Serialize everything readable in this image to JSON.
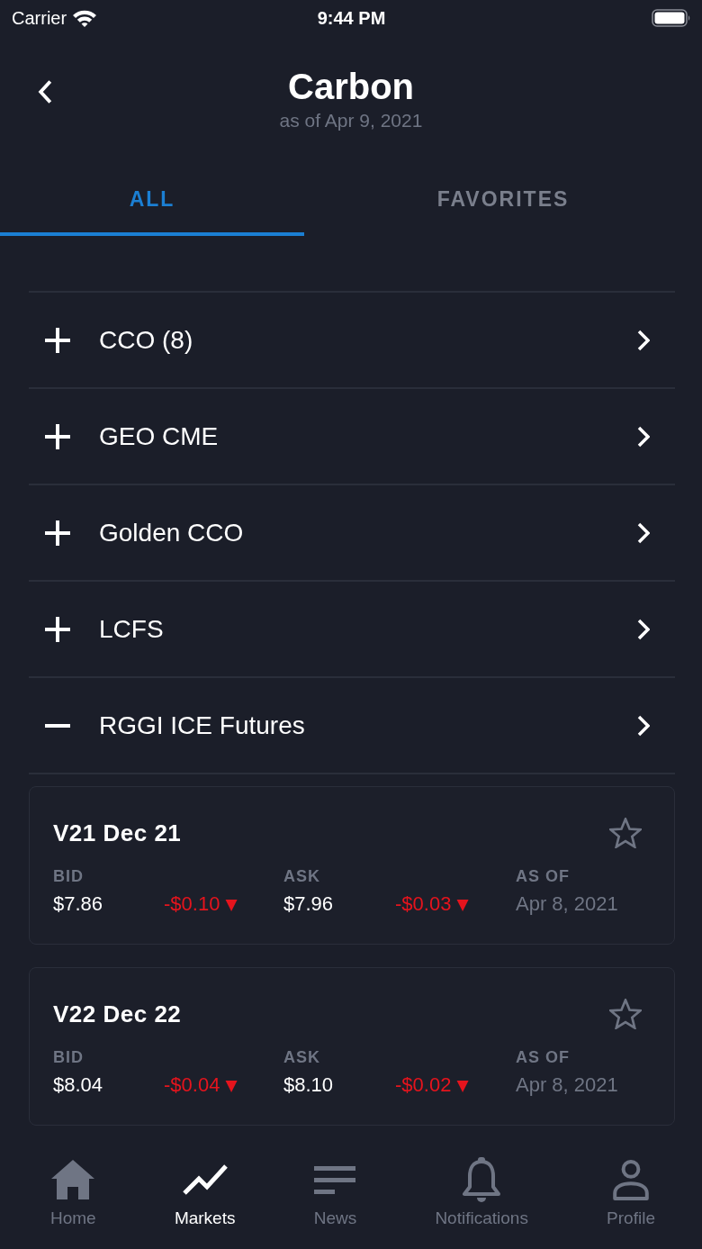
{
  "status_bar": {
    "carrier": "Carrier",
    "time": "9:44 PM"
  },
  "header": {
    "title": "Carbon",
    "subtitle": "as of Apr 9, 2021"
  },
  "tabs": [
    {
      "label": "ALL",
      "selected": true
    },
    {
      "label": "FAVORITES",
      "selected": false
    }
  ],
  "groups": [
    {
      "label": "CCO (8)",
      "expanded": false
    },
    {
      "label": "GEO CME",
      "expanded": false
    },
    {
      "label": "Golden CCO",
      "expanded": false
    },
    {
      "label": "LCFS",
      "expanded": false
    },
    {
      "label": "RGGI ICE Futures",
      "expanded": true,
      "contracts": [
        {
          "name": "V21 Dec 21",
          "favorite": false,
          "bid": {
            "label": "BID",
            "value": "$7.86",
            "change": "-$0.10",
            "arrow": "▼",
            "negative": true
          },
          "ask": {
            "label": "ASK",
            "value": "$7.96",
            "change": "-$0.03",
            "arrow": "▼",
            "negative": true
          },
          "as_of": {
            "label": "AS OF",
            "value": "Apr 8, 2021"
          }
        },
        {
          "name": "V22 Dec 22",
          "favorite": false,
          "bid": {
            "label": "BID",
            "value": "$8.04",
            "change": "-$0.04",
            "arrow": "▼",
            "negative": true
          },
          "ask": {
            "label": "ASK",
            "value": "$8.10",
            "change": "-$0.02",
            "arrow": "▼",
            "negative": true
          },
          "as_of": {
            "label": "AS OF",
            "value": "Apr 8, 2021"
          }
        }
      ]
    }
  ],
  "tab_bar": [
    {
      "label": "Home",
      "kind": "home",
      "selected": false
    },
    {
      "label": "Markets",
      "kind": "markets",
      "selected": true
    },
    {
      "label": "News",
      "kind": "news",
      "selected": false
    },
    {
      "label": "Notifications",
      "kind": "notifications",
      "selected": false
    },
    {
      "label": "Profile",
      "kind": "profile",
      "selected": false
    }
  ]
}
